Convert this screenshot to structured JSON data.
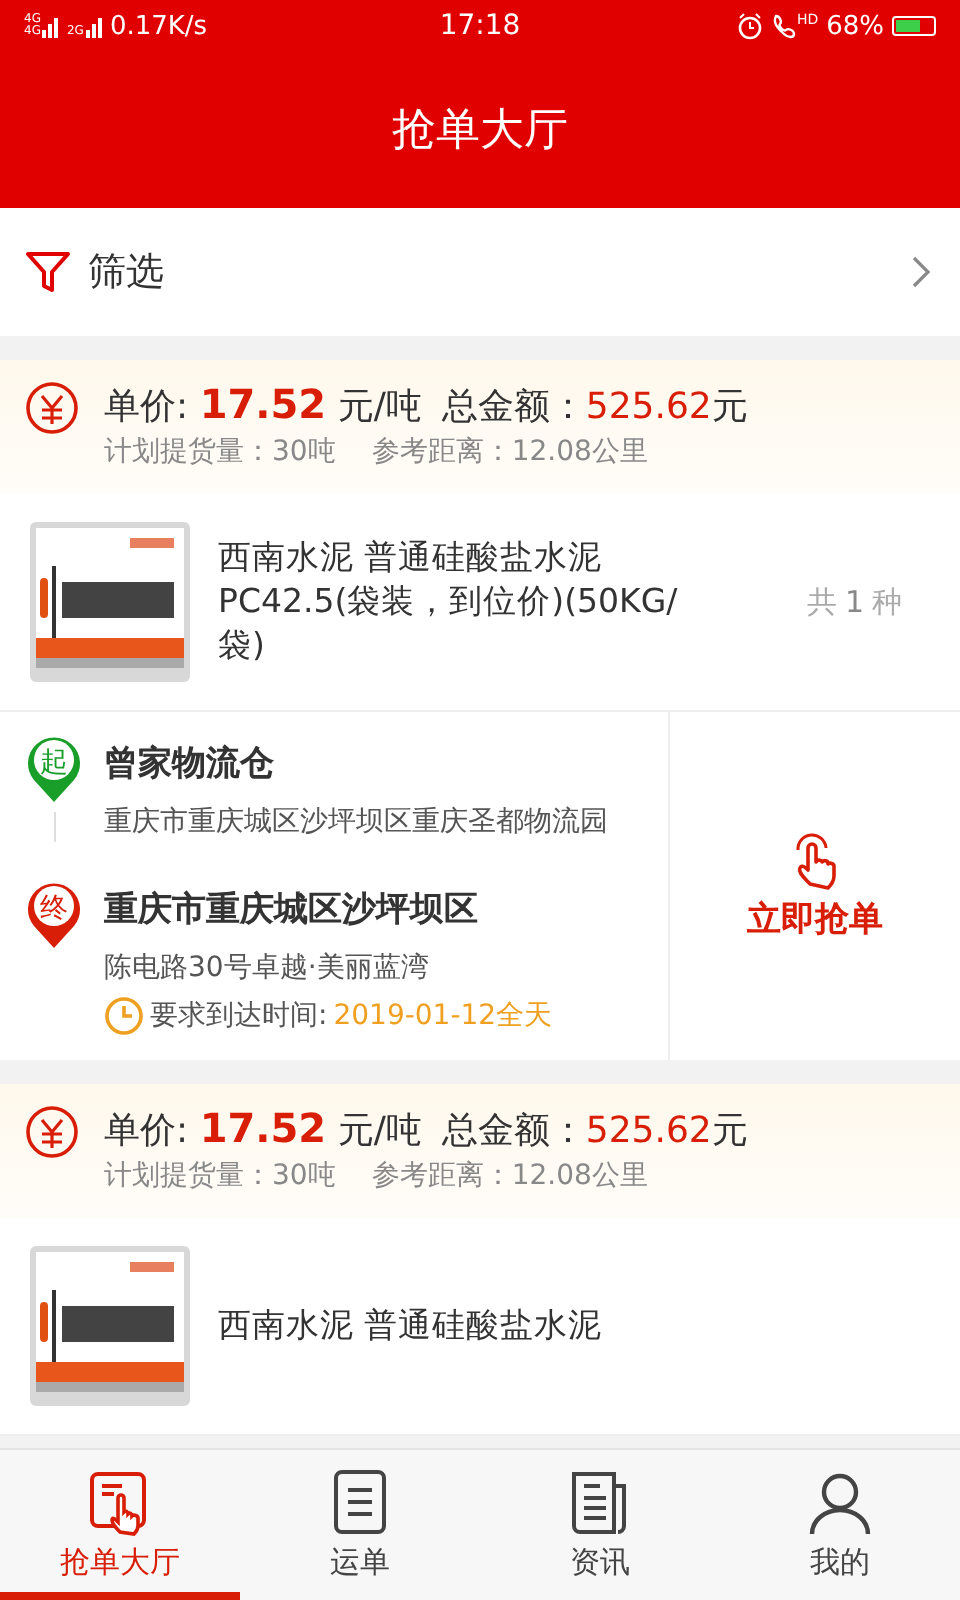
{
  "status_bar": {
    "sim1": [
      "4G",
      "4G"
    ],
    "sim2": [
      "2G"
    ],
    "speed": "0.17K/s",
    "time": "17:18",
    "call": "HD",
    "battery": "68%",
    "charging": true
  },
  "header": {
    "title": "抢单大厅"
  },
  "filter": {
    "label": "筛选"
  },
  "orders": [
    {
      "price_label": "单价:",
      "price": "17.52",
      "price_unit": "元/吨",
      "total_label": "总金额：",
      "total": "525.62",
      "total_unit": "元",
      "quantity": "计划提货量：30吨",
      "distance": "参考距离：12.08公里",
      "product": {
        "name": "西南水泥 普通硅酸盐水泥 PC42.5(袋装，到位价)(50KG/袋)",
        "count_prefix": "共",
        "count": "1",
        "count_suffix": "种"
      },
      "route": {
        "origin_badge": "起",
        "origin_name": "曾家物流仓",
        "origin_address": "重庆市重庆城区沙坪坝区重庆圣都物流园",
        "dest_badge": "终",
        "dest_name": "重庆市重庆城区沙坪坝区",
        "dest_address": "陈电路30号卓越·美丽蓝湾",
        "time_label": "要求到达时间:",
        "time_value": "2019-01-12全天",
        "action": "立即抢单"
      }
    },
    {
      "price_label": "单价:",
      "price": "17.52",
      "price_unit": "元/吨",
      "total_label": "总金额：",
      "total": "525.62",
      "total_unit": "元",
      "quantity": "计划提货量：30吨",
      "distance": "参考距离：12.08公里",
      "product": {
        "name": "西南水泥 普通硅酸盐水泥"
      }
    }
  ],
  "tabs": [
    {
      "label": "抢单大厅",
      "kind": "hall",
      "selected": true
    },
    {
      "label": "运单",
      "kind": "waybill",
      "selected": false
    },
    {
      "label": "资讯",
      "kind": "news",
      "selected": false
    },
    {
      "label": "我的",
      "kind": "profile",
      "selected": false
    }
  ]
}
